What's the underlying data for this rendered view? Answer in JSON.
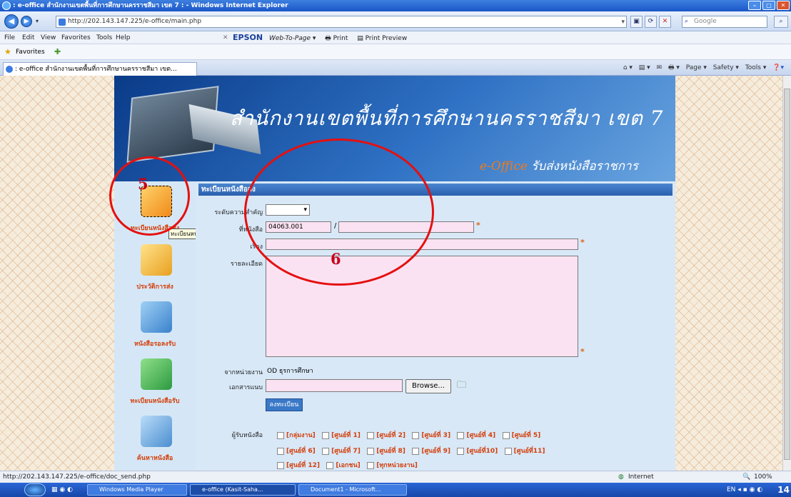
{
  "window": {
    "title": ": e-office สำนักงานเขตพื้นที่การศึกษานครราชสีมา เขต 7 : - Windows Internet Explorer",
    "address": "http://202.143.147.225/e-office/main.php",
    "search_placeholder": "Google"
  },
  "menubar": {
    "file": "File",
    "edit": "Edit",
    "view": "View",
    "favorites": "Favorites",
    "tools": "Tools",
    "help": "Help",
    "epson": "EPSON",
    "web_to_page": "Web-To-Page ▾",
    "print": "Print",
    "print_preview": "Print Preview"
  },
  "favbar": {
    "label": "Favorites"
  },
  "tab": {
    "label": ": e-office สำนักงานเขตพื้นที่การศึกษานครราชสีมา เขต..."
  },
  "cmdbar": {
    "page": "Page ▾",
    "safety": "Safety ▾",
    "tools": "Tools ▾"
  },
  "banner": {
    "title": "สำนักงานเขตพื้นที่การศึกษานครราชสีมา เขต 7",
    "sub_eoffice": "e-Office",
    "sub_text": "รับส่งหนังสือราชการ"
  },
  "leftmenu": {
    "items": [
      {
        "label": "ทะเบียนหนังสือส่ง"
      },
      {
        "label": "ประวัติการส่ง"
      },
      {
        "label": "หนังสือรอลงรับ"
      },
      {
        "label": "ทะเบียนหนังสือรับ"
      },
      {
        "label": "ค้นหาหนังสือ"
      }
    ],
    "tooltip": "ทะเบียนหนังสือส่ง"
  },
  "form": {
    "header": "ทะเบียนหนังสือส่ง",
    "urgency_label": "ระดับความสำคัญ",
    "docno_label": "ที่หนังสือ",
    "docno_value": "04063.001",
    "docno_sep": "/",
    "subject_label": "เรื่อง",
    "detail_label": "รายละเอียด",
    "from_label": "จากหน่วยงาน",
    "from_value": "OD ธุรการศึกษา",
    "attach_label": "เอกสารแนบ",
    "browse": "Browse...",
    "save": "ลงทะเบียน",
    "recipients_label": "ผู้รับหนังสือ",
    "recipients_row1": [
      "[กลุ่มงาน]",
      "[ศูนย์ที่ 1]",
      "[ศูนย์ที่ 2]",
      "[ศูนย์ที่ 3]",
      "[ศูนย์ที่ 4]",
      "[ศูนย์ที่ 5]"
    ],
    "recipients_row2": [
      "[ศูนย์ที่ 6]",
      "[ศูนย์ที่ 7]",
      "[ศูนย์ที่ 8]",
      "[ศูนย์ที่ 9]",
      "[ศูนย์ที่10]",
      "[ศูนย์ที่11]"
    ],
    "recipients_row3": [
      "[ศูนย์ที่ 12]",
      "[เอกชน]",
      "[ทุกหน่วยงาน]"
    ]
  },
  "annotations": {
    "n5": "5",
    "n6": "6"
  },
  "statusbar": {
    "url": "http://202.143.147.225/e-office/doc_send.php",
    "zone": "Internet",
    "zoom": "100%"
  },
  "taskbar": {
    "tasks": [
      "Windows Media Player",
      "e-office (Kasit-Saha...",
      "Document1 - Microsoft..."
    ],
    "clock": "14"
  },
  "colors": {
    "accent": "#2a5fae",
    "required": "#e06010",
    "annotation": "#e41010",
    "input_bg": "#fbe2f2"
  }
}
